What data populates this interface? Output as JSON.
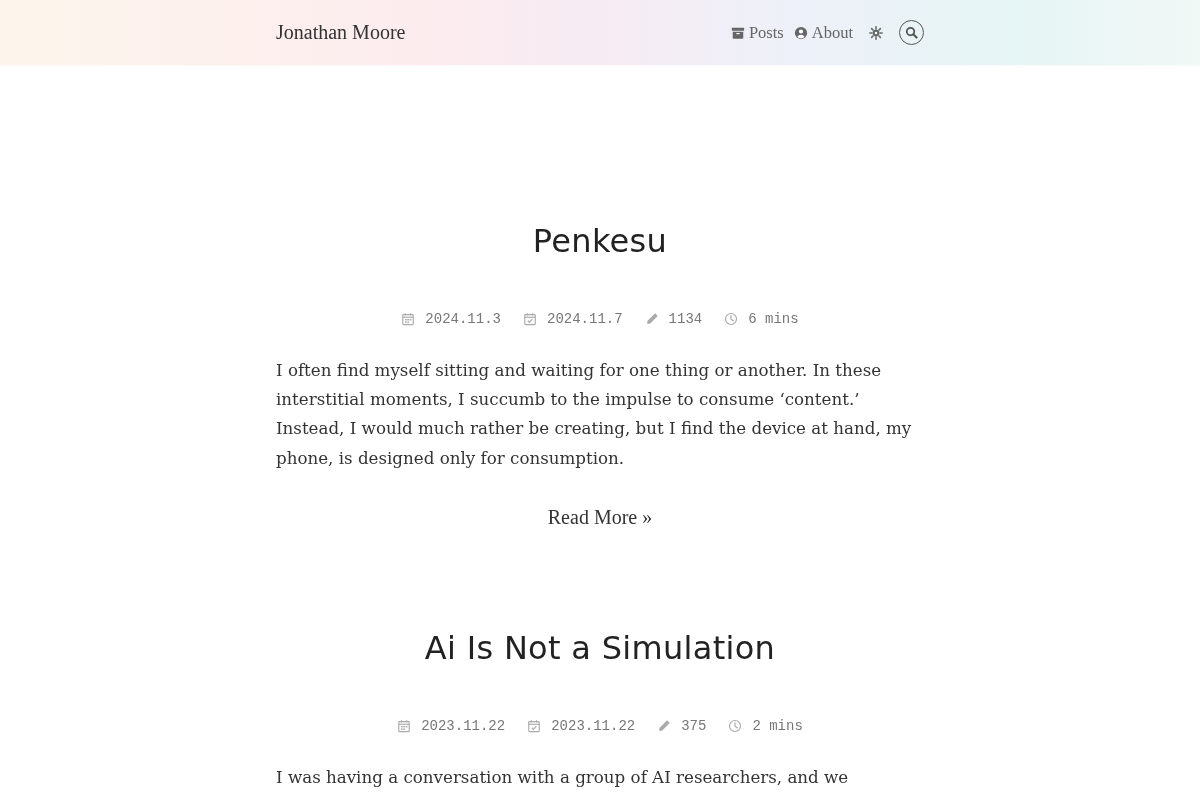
{
  "header": {
    "site_title": "Jonathan Moore",
    "nav": [
      {
        "label": "Posts"
      },
      {
        "label": "About"
      }
    ]
  },
  "posts": [
    {
      "title": "Penkesu",
      "published": "2024.11.3",
      "updated": "2024.11.7",
      "words": "1134",
      "reading_time": "6 mins",
      "excerpt": "I often find myself sitting and waiting for one thing or another. In these interstitial moments, I succumb to the impulse to consume ‘content.’ Instead, I would much rather be creating, but I find the device at hand, my phone, is designed only for consumption.",
      "read_more": "Read More »"
    },
    {
      "title": "Ai Is Not a Simulation",
      "published": "2023.11.22",
      "updated": "2023.11.22",
      "words": "375",
      "reading_time": "2 mins",
      "excerpt": "I was having a conversation with a group of AI researchers, and we"
    }
  ]
}
